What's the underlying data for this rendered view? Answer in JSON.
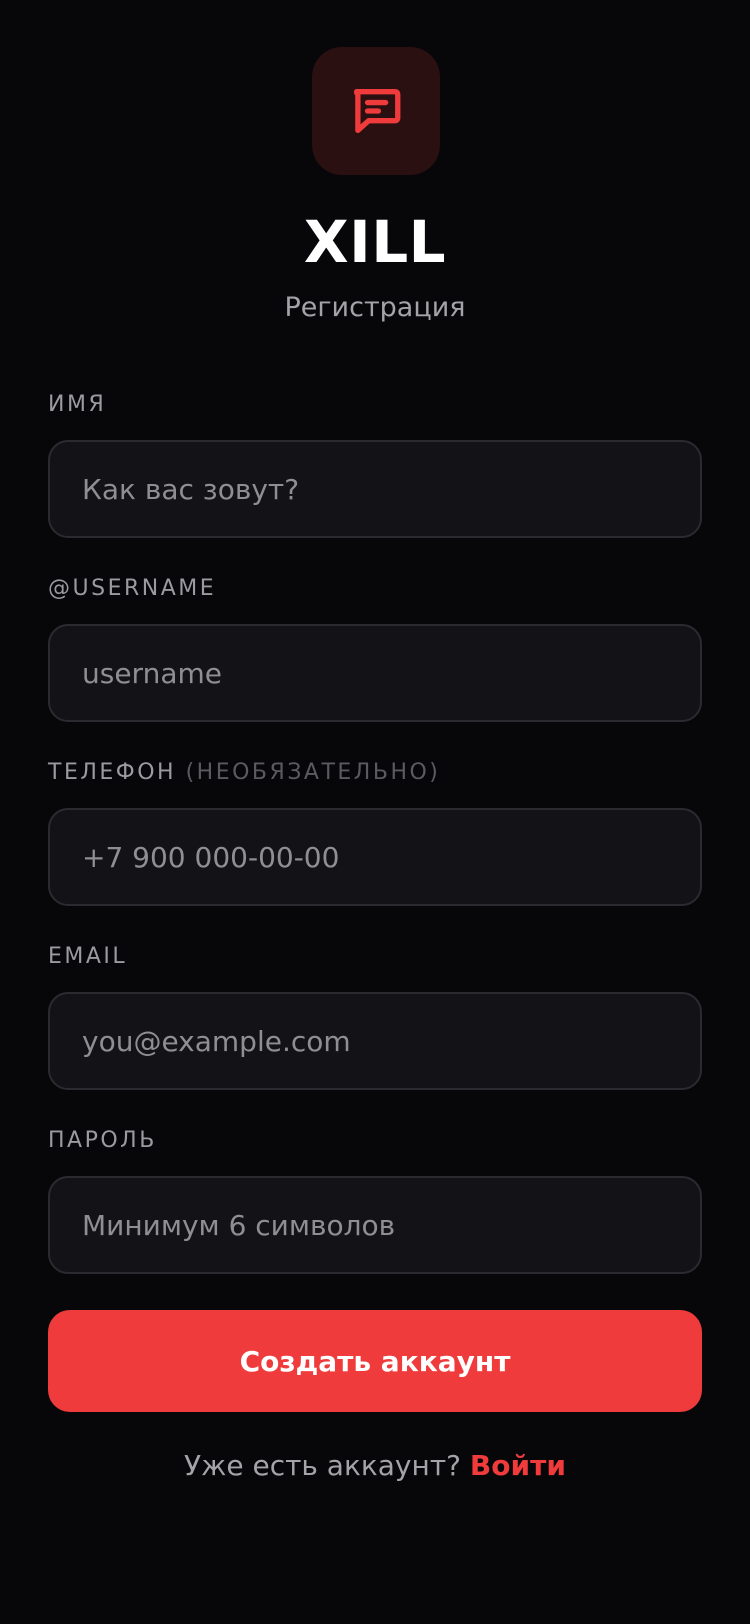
{
  "app": {
    "brand": "XILL",
    "subtitle": "Регистрация",
    "logo_icon": "chat-message-icon"
  },
  "form": {
    "name": {
      "label": "ИМЯ",
      "placeholder": "Как вас зовут?",
      "value": ""
    },
    "username": {
      "label": "@USERNAME",
      "placeholder": "username",
      "value": ""
    },
    "phone": {
      "label": "ТЕЛЕФОН",
      "label_hint": "(НЕОБЯЗАТЕЛЬНО)",
      "placeholder": "+7 900 000-00-00",
      "value": ""
    },
    "email": {
      "label": "EMAIL",
      "placeholder": "you@example.com",
      "value": ""
    },
    "password": {
      "label": "ПАРОЛЬ",
      "placeholder": "Минимум 6 символов",
      "value": ""
    },
    "submit_label": "Создать аккаунт"
  },
  "footer": {
    "prompt": "Уже есть аккаунт?",
    "login_label": "Войти"
  },
  "colors": {
    "accent": "#ef3b3b",
    "background": "#070709",
    "input_background": "#131317",
    "logo_background": "#2b1012"
  }
}
